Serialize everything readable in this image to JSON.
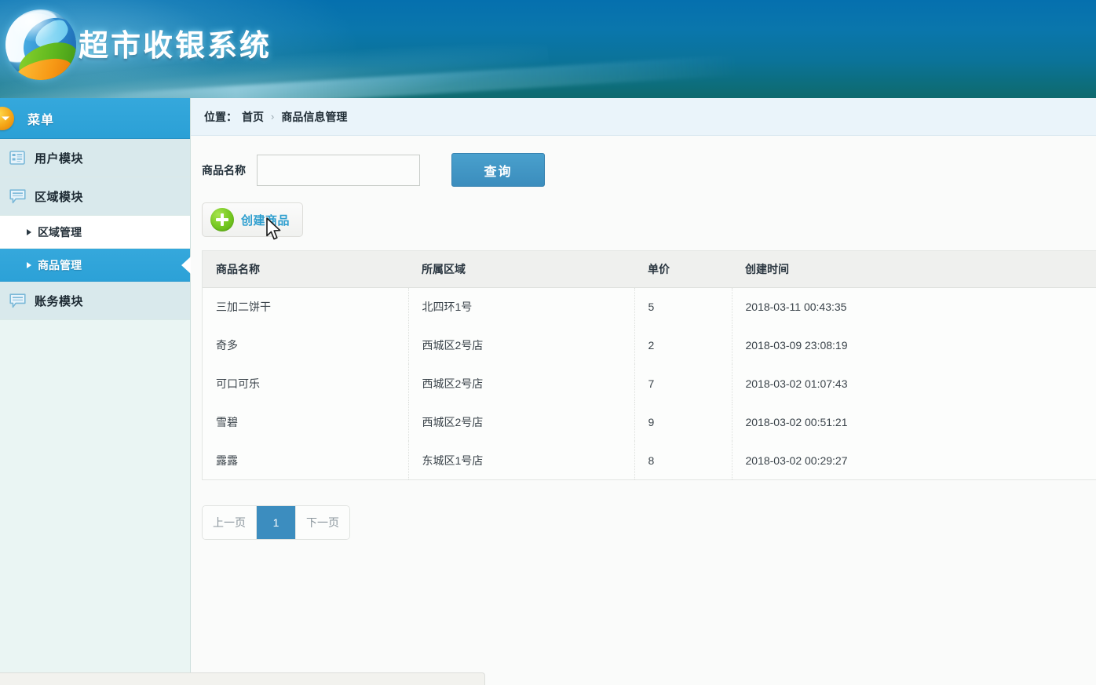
{
  "app": {
    "title": "超市收银系统",
    "logo_icon": "globe-sphere-logo"
  },
  "sidebar": {
    "menu_header": {
      "label": "菜单",
      "icon": "chevron-down-circle-icon"
    },
    "items": [
      {
        "label": "用户模块",
        "icon": "list-grid-icon",
        "type": "module",
        "active": false
      },
      {
        "label": "区域模块",
        "icon": "speech-bubble-icon",
        "type": "module",
        "active": false
      },
      {
        "label": "区域管理",
        "icon": "triangle-bullet-icon",
        "type": "sub",
        "active": false
      },
      {
        "label": "商品管理",
        "icon": "triangle-bullet-icon",
        "type": "sub",
        "active": true
      },
      {
        "label": "账务模块",
        "icon": "speech-bubble-icon",
        "type": "module",
        "active": false
      }
    ]
  },
  "breadcrumb": {
    "label": "位置：",
    "home": "首页",
    "separator": "›",
    "current": "商品信息管理"
  },
  "search": {
    "label": "商品名称",
    "value": "",
    "placeholder": "",
    "button_label": "查询"
  },
  "toolbar": {
    "create_label": "创建商品",
    "create_icon": "plus-circle-icon"
  },
  "table": {
    "columns": [
      "商品名称",
      "所属区域",
      "单价",
      "创建时间"
    ],
    "rows": [
      {
        "name": "三加二饼干",
        "region": "北四环1号",
        "price": "5",
        "created": "2018-03-11 00:43:35"
      },
      {
        "name": "奇多",
        "region": "西城区2号店",
        "price": "2",
        "created": "2018-03-09 23:08:19"
      },
      {
        "name": "可口可乐",
        "region": "西城区2号店",
        "price": "7",
        "created": "2018-03-02 01:07:43"
      },
      {
        "name": "雪碧",
        "region": "西城区2号店",
        "price": "9",
        "created": "2018-03-02 00:51:21"
      },
      {
        "name": "露露",
        "region": "东城区1号店",
        "price": "8",
        "created": "2018-03-02 00:29:27"
      }
    ]
  },
  "pagination": {
    "prev_label": "上一页",
    "next_label": "下一页",
    "pages": [
      "1"
    ],
    "current_page": "1"
  },
  "status_bar": {
    "text": ""
  },
  "colors": {
    "header_top": "#0570ae",
    "header_bottom": "#0f6a6e",
    "accent_blue": "#3c8dbf",
    "active_nav": "#2ca1d7",
    "sidebar_bg": "#d9e9ec",
    "create_label": "#2f9fcf",
    "plus_green": "#79cb24",
    "menu_orange": "#f5a617"
  }
}
